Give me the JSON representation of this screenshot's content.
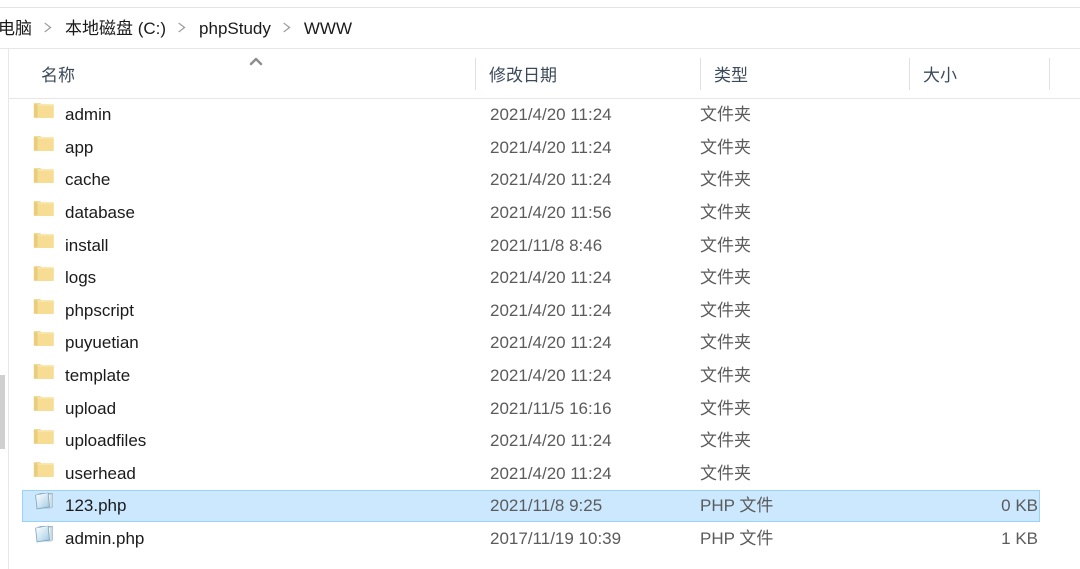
{
  "window": {
    "title": "WWW",
    "app": "file-explorer"
  },
  "breadcrumb": {
    "separator_icon": "chevron-right-icon",
    "items": [
      {
        "label": "电脑"
      },
      {
        "label": "本地磁盘 (C:)"
      },
      {
        "label": "phpStudy"
      },
      {
        "label": "WWW"
      }
    ]
  },
  "columns": {
    "sort_indicator": "^",
    "sort_column": "名称",
    "sort_direction": "ascending",
    "headers": [
      {
        "key": "name",
        "label": "名称"
      },
      {
        "key": "date",
        "label": "修改日期"
      },
      {
        "key": "type",
        "label": "类型"
      },
      {
        "key": "size",
        "label": "大小"
      }
    ]
  },
  "colors": {
    "selection_fill": "#cce8ff",
    "selection_border": "#99d1ff",
    "folder_icon": "#f7dc94",
    "folder_icon_tab": "#ead183",
    "header_text": "#3b4a5a",
    "secondary_text": "#5b5b5b"
  },
  "files": [
    {
      "icon": "folder-icon",
      "name": "admin",
      "date": "2021/4/20 11:24",
      "type": "文件夹",
      "size": "",
      "selected": false
    },
    {
      "icon": "folder-icon",
      "name": "app",
      "date": "2021/4/20 11:24",
      "type": "文件夹",
      "size": "",
      "selected": false
    },
    {
      "icon": "folder-icon",
      "name": "cache",
      "date": "2021/4/20 11:24",
      "type": "文件夹",
      "size": "",
      "selected": false
    },
    {
      "icon": "folder-icon",
      "name": "database",
      "date": "2021/4/20 11:56",
      "type": "文件夹",
      "size": "",
      "selected": false
    },
    {
      "icon": "folder-icon",
      "name": "install",
      "date": "2021/11/8 8:46",
      "type": "文件夹",
      "size": "",
      "selected": false
    },
    {
      "icon": "folder-icon",
      "name": "logs",
      "date": "2021/4/20 11:24",
      "type": "文件夹",
      "size": "",
      "selected": false
    },
    {
      "icon": "folder-icon",
      "name": "phpscript",
      "date": "2021/4/20 11:24",
      "type": "文件夹",
      "size": "",
      "selected": false
    },
    {
      "icon": "folder-icon",
      "name": "puyuetian",
      "date": "2021/4/20 11:24",
      "type": "文件夹",
      "size": "",
      "selected": false
    },
    {
      "icon": "folder-icon",
      "name": "template",
      "date": "2021/4/20 11:24",
      "type": "文件夹",
      "size": "",
      "selected": false
    },
    {
      "icon": "folder-icon",
      "name": "upload",
      "date": "2021/11/5 16:16",
      "type": "文件夹",
      "size": "",
      "selected": false
    },
    {
      "icon": "folder-icon",
      "name": "uploadfiles",
      "date": "2021/4/20 11:24",
      "type": "文件夹",
      "size": "",
      "selected": false
    },
    {
      "icon": "folder-icon",
      "name": "userhead",
      "date": "2021/4/20 11:24",
      "type": "文件夹",
      "size": "",
      "selected": false
    },
    {
      "icon": "php-file-icon",
      "name": "123.php",
      "date": "2021/11/8 9:25",
      "type": "PHP 文件",
      "size": "0 KB",
      "selected": true
    },
    {
      "icon": "php-file-icon",
      "name": "admin.php",
      "date": "2017/11/19 10:39",
      "type": "PHP 文件",
      "size": "1 KB",
      "selected": false
    }
  ]
}
